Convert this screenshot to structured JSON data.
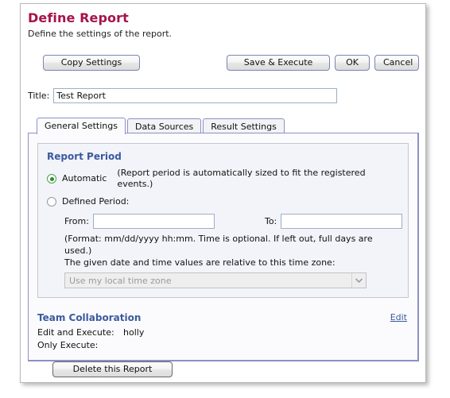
{
  "header": {
    "title": "Define Report",
    "subtitle": "Define the settings of the report."
  },
  "toolbar": {
    "copy_settings_label": "Copy Settings",
    "save_execute_label": "Save & Execute",
    "ok_label": "OK",
    "cancel_label": "Cancel"
  },
  "title_field": {
    "label": "Title:",
    "value": "Test Report"
  },
  "tabs": [
    {
      "label": "General Settings",
      "active": true
    },
    {
      "label": "Data Sources",
      "active": false
    },
    {
      "label": "Result Settings",
      "active": false
    }
  ],
  "report_period": {
    "heading": "Report Period",
    "automatic_label": "Automatic",
    "automatic_hint": "(Report period is automatically sized to fit the registered events.)",
    "defined_label": "Defined Period:",
    "from_label": "From:",
    "from_value": "",
    "to_label": "To:",
    "to_value": "",
    "format_hint": "(Format: mm/dd/yyyy hh:mm. Time is optional. If left out, full days are used.)",
    "timezone_hint": "The given date and time values are relative to this time zone:",
    "timezone_value": "Use my local time zone"
  },
  "team_collaboration": {
    "heading": "Team Collaboration",
    "edit_link": "Edit",
    "edit_execute_label": "Edit and Execute:",
    "edit_execute_value": "holly",
    "only_execute_label": "Only Execute:",
    "only_execute_value": ""
  },
  "footer": {
    "delete_label": "Delete this Report"
  },
  "colors": {
    "title": "#a5134a",
    "section_heading": "#3b5a9e",
    "link": "#3b5a9e",
    "radio_selected": "#269026",
    "panel_border": "#8d90c4"
  }
}
